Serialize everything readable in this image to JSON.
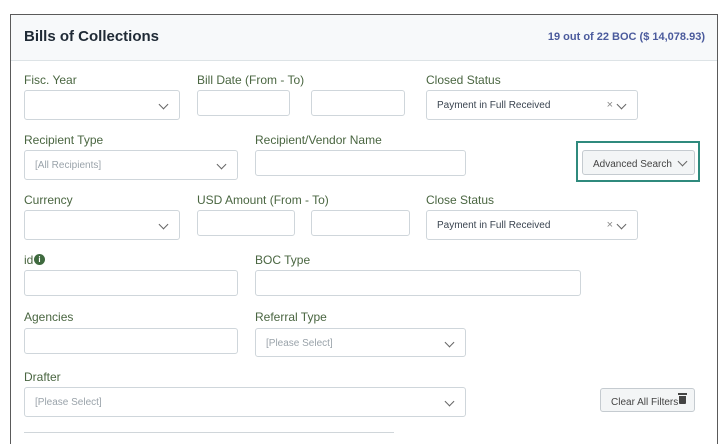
{
  "header": {
    "title": "Bills of Collections",
    "summary": "19 out of 22 BOC ($ 14,078.93)"
  },
  "filters": {
    "fisc_year": {
      "label": "Fisc. Year",
      "value": ""
    },
    "bill_date": {
      "label": "Bill Date (From - To)",
      "from": "",
      "to": ""
    },
    "closed_status": {
      "label": "Closed Status",
      "value": "Payment in Full Received"
    },
    "recipient_type": {
      "label": "Recipient Type",
      "placeholder": "[All Recipients]"
    },
    "recipient_vendor_name": {
      "label": "Recipient/Vendor Name",
      "value": ""
    },
    "currency": {
      "label": "Currency",
      "value": ""
    },
    "usd_amount": {
      "label": "USD Amount (From - To)",
      "from": "",
      "to": ""
    },
    "close_status": {
      "label": "Close Status",
      "value": "Payment in Full Received"
    },
    "id": {
      "label": "id",
      "value": ""
    },
    "boc_type": {
      "label": "BOC Type",
      "value": ""
    },
    "agencies": {
      "label": "Agencies",
      "value": ""
    },
    "referral_type": {
      "label": "Referral Type",
      "placeholder": "[Please Select]"
    },
    "drafter": {
      "label": "Drafter",
      "placeholder": "[Please Select]"
    }
  },
  "buttons": {
    "advanced_search": "Advanced Search",
    "clear_all_filters": "Clear All Filters"
  },
  "icons": {
    "chevron": "chevron-down-icon",
    "clear": "clear-x-icon",
    "info": "info-icon",
    "trash": "trash-icon"
  },
  "colors": {
    "label_green": "#4a6641",
    "summary_blue": "#4a5a9c",
    "highlight_teal": "#2f8a7d"
  }
}
